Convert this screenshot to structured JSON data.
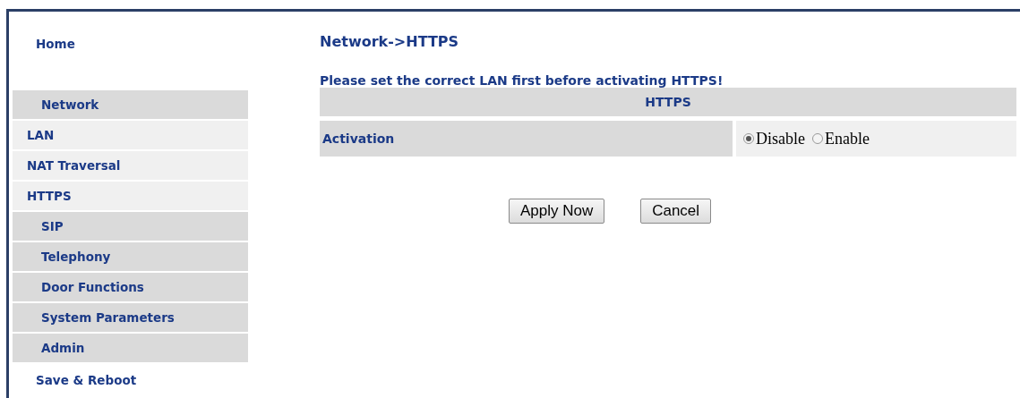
{
  "sidebar": {
    "items": [
      {
        "label": "Home",
        "kind": "top"
      },
      {
        "label": "Network",
        "kind": "section"
      },
      {
        "label": "LAN",
        "kind": "sub"
      },
      {
        "label": "NAT Traversal",
        "kind": "sub"
      },
      {
        "label": "HTTPS",
        "kind": "sub"
      },
      {
        "label": "SIP",
        "kind": "section"
      },
      {
        "label": "Telephony",
        "kind": "section"
      },
      {
        "label": "Door Functions",
        "kind": "section"
      },
      {
        "label": "System Parameters",
        "kind": "section"
      },
      {
        "label": "Admin",
        "kind": "section"
      },
      {
        "label": "Save & Reboot",
        "kind": "top"
      }
    ]
  },
  "main": {
    "title": "Network->HTTPS",
    "warning": "Please set the correct LAN first before activating HTTPS!",
    "table": {
      "header": "HTTPS",
      "rows": [
        {
          "label": "Activation",
          "options": [
            {
              "label": "Disable",
              "selected": true
            },
            {
              "label": "Enable",
              "selected": false
            }
          ]
        }
      ]
    },
    "buttons": [
      "Apply Now",
      "Cancel"
    ]
  }
}
